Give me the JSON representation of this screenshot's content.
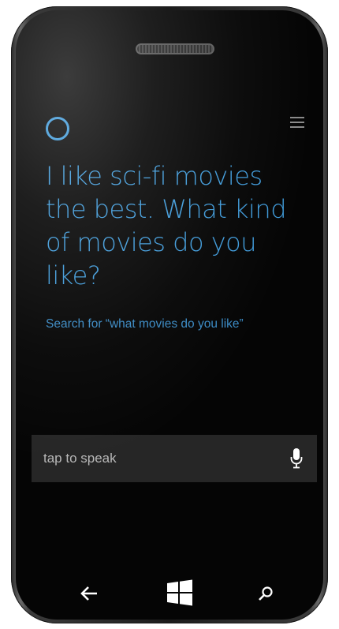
{
  "cortana": {
    "response": "I like sci-fi movies the best. What kind of movies do you like?",
    "search_suggestion": "Search for “what movies do you like”"
  },
  "speak_bar": {
    "label": "tap to speak",
    "icon": "microphone-icon"
  },
  "nav_bar": {
    "items": [
      {
        "icon": "back-arrow-icon"
      },
      {
        "icon": "windows-logo-icon"
      },
      {
        "icon": "search-icon"
      }
    ]
  },
  "colors": {
    "accent": "#3f9ad9",
    "background": "#050505",
    "speak_bar": "#262626"
  }
}
